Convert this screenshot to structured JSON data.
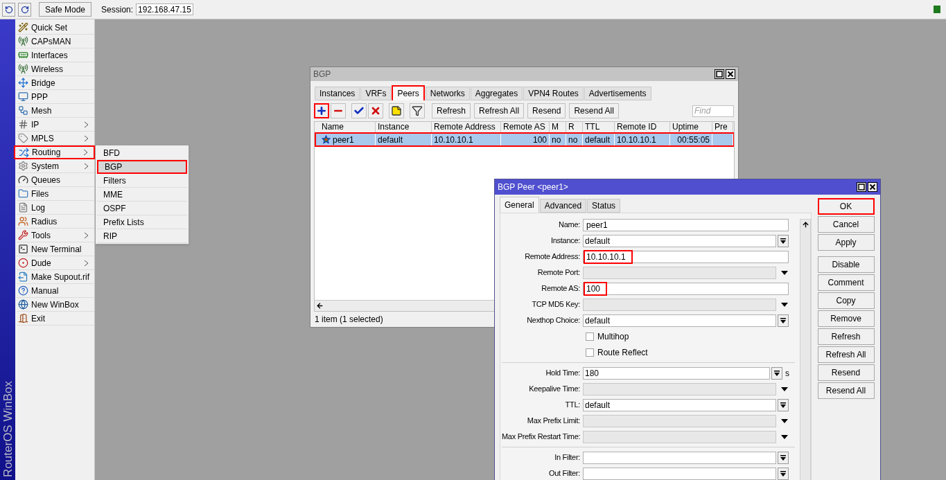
{
  "toolbar": {
    "safe_mode": "Safe Mode",
    "session_label": "Session:",
    "session_value": "192.168.47.15"
  },
  "brand": "RouterOS WinBox",
  "sidebar": {
    "items": [
      {
        "label": "Quick Set",
        "has_submenu": false,
        "highlighted": false
      },
      {
        "label": "CAPsMAN",
        "has_submenu": false,
        "highlighted": false
      },
      {
        "label": "Interfaces",
        "has_submenu": false,
        "highlighted": false
      },
      {
        "label": "Wireless",
        "has_submenu": false,
        "highlighted": false
      },
      {
        "label": "Bridge",
        "has_submenu": false,
        "highlighted": false
      },
      {
        "label": "PPP",
        "has_submenu": false,
        "highlighted": false
      },
      {
        "label": "Mesh",
        "has_submenu": false,
        "highlighted": false
      },
      {
        "label": "IP",
        "has_submenu": true,
        "highlighted": false
      },
      {
        "label": "MPLS",
        "has_submenu": true,
        "highlighted": false
      },
      {
        "label": "Routing",
        "has_submenu": true,
        "highlighted": true
      },
      {
        "label": "System",
        "has_submenu": true,
        "highlighted": false
      },
      {
        "label": "Queues",
        "has_submenu": false,
        "highlighted": false
      },
      {
        "label": "Files",
        "has_submenu": false,
        "highlighted": false
      },
      {
        "label": "Log",
        "has_submenu": false,
        "highlighted": false
      },
      {
        "label": "Radius",
        "has_submenu": false,
        "highlighted": false
      },
      {
        "label": "Tools",
        "has_submenu": true,
        "highlighted": false
      },
      {
        "label": "New Terminal",
        "has_submenu": false,
        "highlighted": false
      },
      {
        "label": "Dude",
        "has_submenu": true,
        "highlighted": false
      },
      {
        "label": "Make Supout.rif",
        "has_submenu": false,
        "highlighted": false
      },
      {
        "label": "Manual",
        "has_submenu": false,
        "highlighted": false
      },
      {
        "label": "New WinBox",
        "has_submenu": false,
        "highlighted": false
      },
      {
        "label": "Exit",
        "has_submenu": false,
        "highlighted": false
      }
    ]
  },
  "submenu": {
    "items": [
      {
        "label": "BFD",
        "selected": false,
        "highlighted": false
      },
      {
        "label": "BGP",
        "selected": true,
        "highlighted": true
      },
      {
        "label": "Filters",
        "selected": false,
        "highlighted": false
      },
      {
        "label": "MME",
        "selected": false,
        "highlighted": false
      },
      {
        "label": "OSPF",
        "selected": false,
        "highlighted": false
      },
      {
        "label": "Prefix Lists",
        "selected": false,
        "highlighted": false
      },
      {
        "label": "RIP",
        "selected": false,
        "highlighted": false
      }
    ]
  },
  "bgp_window": {
    "title": "BGP",
    "tabs": [
      {
        "label": "Instances",
        "selected": false,
        "highlighted": false
      },
      {
        "label": "VRFs",
        "selected": false,
        "highlighted": false
      },
      {
        "label": "Peers",
        "selected": true,
        "highlighted": true
      },
      {
        "label": "Networks",
        "selected": false,
        "highlighted": false
      },
      {
        "label": "Aggregates",
        "selected": false,
        "highlighted": false
      },
      {
        "label": "VPN4 Routes",
        "selected": false,
        "highlighted": false
      },
      {
        "label": "Advertisements",
        "selected": false,
        "highlighted": false
      }
    ],
    "icon_buttons": [
      {
        "kind": "add",
        "highlighted": true
      },
      {
        "kind": "remove",
        "highlighted": false
      },
      {
        "kind": "enable",
        "highlighted": false
      },
      {
        "kind": "disable",
        "highlighted": false
      },
      {
        "kind": "comment",
        "highlighted": false
      },
      {
        "kind": "filter",
        "highlighted": false
      }
    ],
    "text_buttons": [
      "Refresh",
      "Refresh All",
      "Resend",
      "Resend All"
    ],
    "find": {
      "placeholder": "Find"
    },
    "table": {
      "columns": [
        "Name",
        "Instance",
        "Remote Address",
        "Remote AS",
        "M",
        "R",
        "TTL",
        "Remote ID",
        "Uptime",
        "Pre"
      ],
      "rows": [
        {
          "cells": [
            "peer1",
            "default",
            "10.10.10.1",
            "100",
            "no",
            "no",
            "default",
            "10.10.10.1",
            "00:55:05",
            ""
          ],
          "selected": true,
          "highlighted": true
        }
      ]
    },
    "status": "1 item (1 selected)"
  },
  "peer_window": {
    "title": "BGP Peer <peer1>",
    "tabs": [
      {
        "label": "General",
        "selected": true
      },
      {
        "label": "Advanced",
        "selected": false
      },
      {
        "label": "Status",
        "selected": false
      }
    ],
    "fields": [
      {
        "kind": "text",
        "label": "Name:",
        "value": "peer1",
        "highlighted": false
      },
      {
        "kind": "combo",
        "label": "Instance:",
        "value": "default",
        "highlighted": false
      },
      {
        "kind": "text",
        "label": "Remote Address:",
        "value": "10.10.10.1",
        "highlighted": true
      },
      {
        "kind": "dropdown",
        "label": "Remote Port:"
      },
      {
        "kind": "text",
        "label": "Remote AS:",
        "value": "100",
        "highlighted": true
      },
      {
        "kind": "dropdown",
        "label": "TCP MD5 Key:"
      },
      {
        "kind": "combo",
        "label": "Nexthop Choice:",
        "value": "default",
        "highlighted": false
      },
      {
        "kind": "checkbox",
        "label": "Multihop",
        "checked": false
      },
      {
        "kind": "checkbox",
        "label": "Route Reflect",
        "checked": false
      },
      {
        "kind": "divider"
      },
      {
        "kind": "combo",
        "label": "Hold Time:",
        "value": "180",
        "suffix": "s",
        "highlighted": false
      },
      {
        "kind": "dropdown",
        "label": "Keepalive Time:"
      },
      {
        "kind": "combo",
        "label": "TTL:",
        "value": "default",
        "highlighted": false
      },
      {
        "kind": "dropdown",
        "label": "Max Prefix Limit:"
      },
      {
        "kind": "dropdown",
        "label": "Max Prefix Restart Time:"
      },
      {
        "kind": "divider"
      },
      {
        "kind": "combo",
        "label": "In Filter:"
      },
      {
        "kind": "combo",
        "label": "Out Filter:"
      }
    ],
    "buttons": [
      {
        "label": "OK",
        "highlighted": true
      },
      {
        "label": "Cancel",
        "highlighted": false
      },
      {
        "label": "Apply",
        "highlighted": false
      },
      {
        "label": "Disable",
        "highlighted": false
      },
      {
        "label": "Comment",
        "highlighted": false
      },
      {
        "label": "Copy",
        "highlighted": false
      },
      {
        "label": "Remove",
        "highlighted": false
      },
      {
        "label": "Refresh",
        "highlighted": false
      },
      {
        "label": "Refresh All",
        "highlighted": false
      },
      {
        "label": "Resend",
        "highlighted": false
      },
      {
        "label": "Resend All",
        "highlighted": false
      }
    ]
  }
}
